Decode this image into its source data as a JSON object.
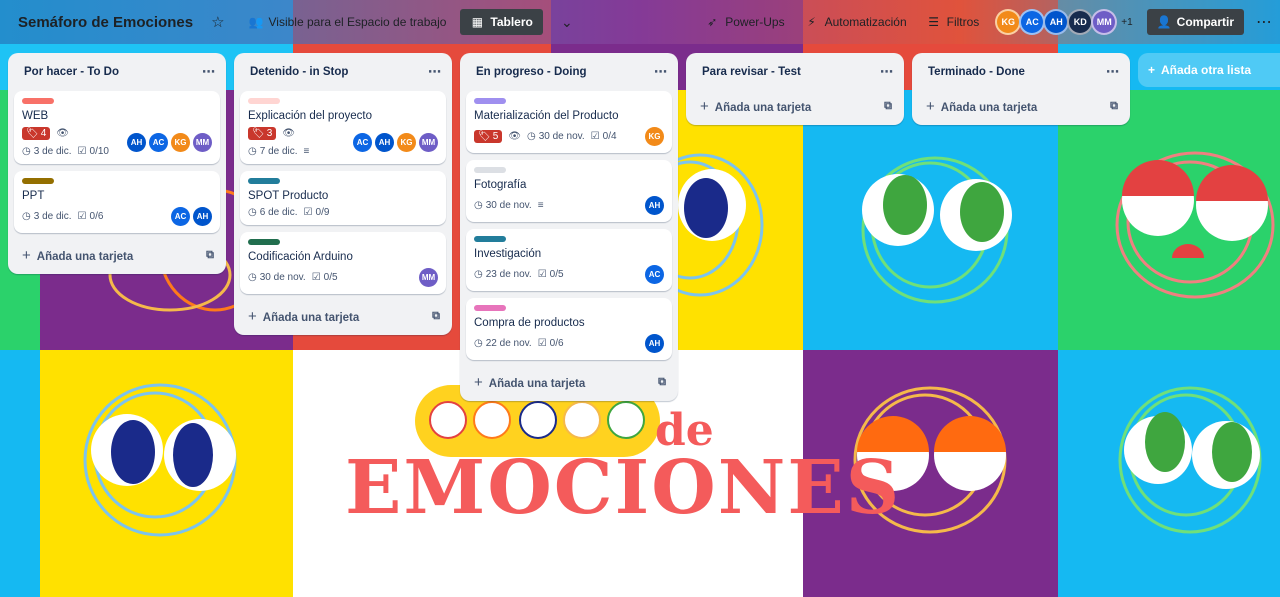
{
  "header": {
    "board_title": "Semáforo de Emociones",
    "visibility": "Visible para el Espacio de trabajo",
    "view": "Tablero",
    "power_ups": "Power-Ups",
    "automation": "Automatización",
    "filters": "Filtros",
    "members": [
      "KG",
      "AC",
      "AH",
      "KD",
      "MM"
    ],
    "more_members": "+1",
    "share": "Compartir"
  },
  "lists": [
    {
      "title": "Por hacer - To Do",
      "add_card": "Añada una tarjeta",
      "cards": [
        {
          "label_color": "#f87168",
          "title": "WEB",
          "votes": "4",
          "watch": true,
          "due": "3 de dic.",
          "checklist": "0/10",
          "members": [
            "AH",
            "AC",
            "KG",
            "MM"
          ]
        },
        {
          "label_color": "#946f00",
          "title": "PPT",
          "due": "3 de dic.",
          "checklist": "0/6",
          "members": [
            "AC",
            "AH"
          ]
        }
      ]
    },
    {
      "title": "Detenido - in Stop",
      "add_card": "Añada una tarjeta",
      "cards": [
        {
          "label_color": "#ffd5d2",
          "title": "Explicación del proyecto",
          "votes": "3",
          "watch": true,
          "due": "7 de dic.",
          "description": true,
          "members": [
            "AC",
            "AH",
            "KG",
            "MM"
          ]
        },
        {
          "label_color": "#227d9b",
          "title": "SPOT Producto",
          "due": "6 de dic.",
          "checklist": "0/9",
          "members": []
        },
        {
          "label_color": "#216e4e",
          "title": "Codificación Arduino",
          "due": "30 de nov.",
          "checklist": "0/5",
          "members": [
            "MM"
          ]
        }
      ]
    },
    {
      "title": "En progreso - Doing",
      "add_card": "Añada una tarjeta",
      "cards": [
        {
          "label_color": "#9f8fef",
          "title": "Materialización del Producto",
          "votes": "5",
          "watch": true,
          "due": "30 de nov.",
          "checklist": "0/4",
          "members": [
            "KG"
          ]
        },
        {
          "label_color": "#dcdfe4",
          "title": "Fotografía",
          "due": "30 de nov.",
          "description": true,
          "members": [
            "AH"
          ]
        },
        {
          "label_color": "#227d9b",
          "title": "Investigación",
          "due": "23 de nov.",
          "checklist": "0/5",
          "members": [
            "AC"
          ]
        },
        {
          "label_color": "#e774bb",
          "title": "Compra de productos",
          "due": "22 de nov.",
          "checklist": "0/6",
          "members": [
            "AH"
          ]
        }
      ]
    },
    {
      "title": "Para revisar - Test",
      "add_card": "Añada una tarjeta",
      "cards": []
    },
    {
      "title": "Terminado - Done",
      "add_card": "Añada una tarjeta",
      "cards": []
    }
  ],
  "add_list": "Añada otra lista",
  "background_art": {
    "word_top": "de",
    "word_main": "EMOCIONES"
  },
  "colors": {
    "vote_badge": "#c9372c",
    "list_bg": "#f1f2f4",
    "board_button": "#3b4146"
  }
}
